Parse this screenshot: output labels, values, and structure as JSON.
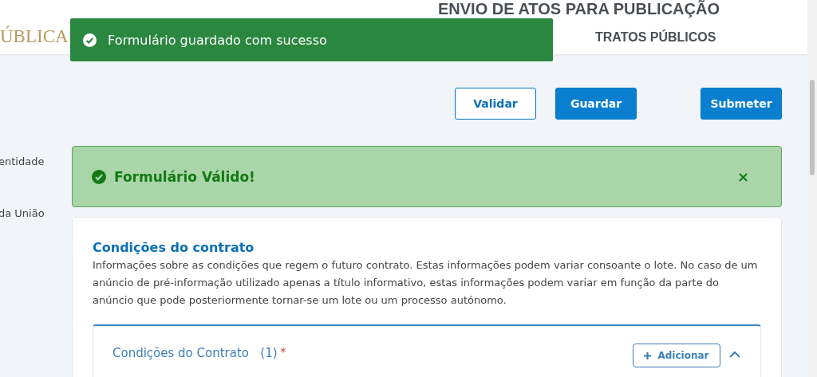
{
  "header": {
    "logo": "ÚBLICA",
    "title": "ENVIO DE ATOS PARA PUBLICAÇÃO",
    "subtitle": "TRATOS PÚBLICOS"
  },
  "toast": {
    "message": "Formulário guardado com sucesso"
  },
  "sidebar": {
    "items": [
      {
        "label": "entidade"
      },
      {
        "label": "da União"
      }
    ]
  },
  "actions": [
    {
      "label": "Validar",
      "kind": "outline"
    },
    {
      "label": "Guardar",
      "kind": "primary"
    },
    {
      "label": "Submeter",
      "kind": "primary"
    }
  ],
  "alert": {
    "message": "Formulário Válido!",
    "close": "×"
  },
  "section": {
    "title": "Condições do contrato",
    "description": "Informações sobre as condições que regem o futuro contrato. Estas informações podem variar consoante o lote. No caso de um anúncio de pré-informação utilizado apenas a título informativo, estas informações podem variar em função da parte do anúncio que pode posteriormente tornar-se um lote ou um processo autónomo.",
    "panel": {
      "title": "Condições do Contrato",
      "count": "(1)",
      "required": "*",
      "add_label": "Adicionar",
      "expanded": true
    }
  }
}
